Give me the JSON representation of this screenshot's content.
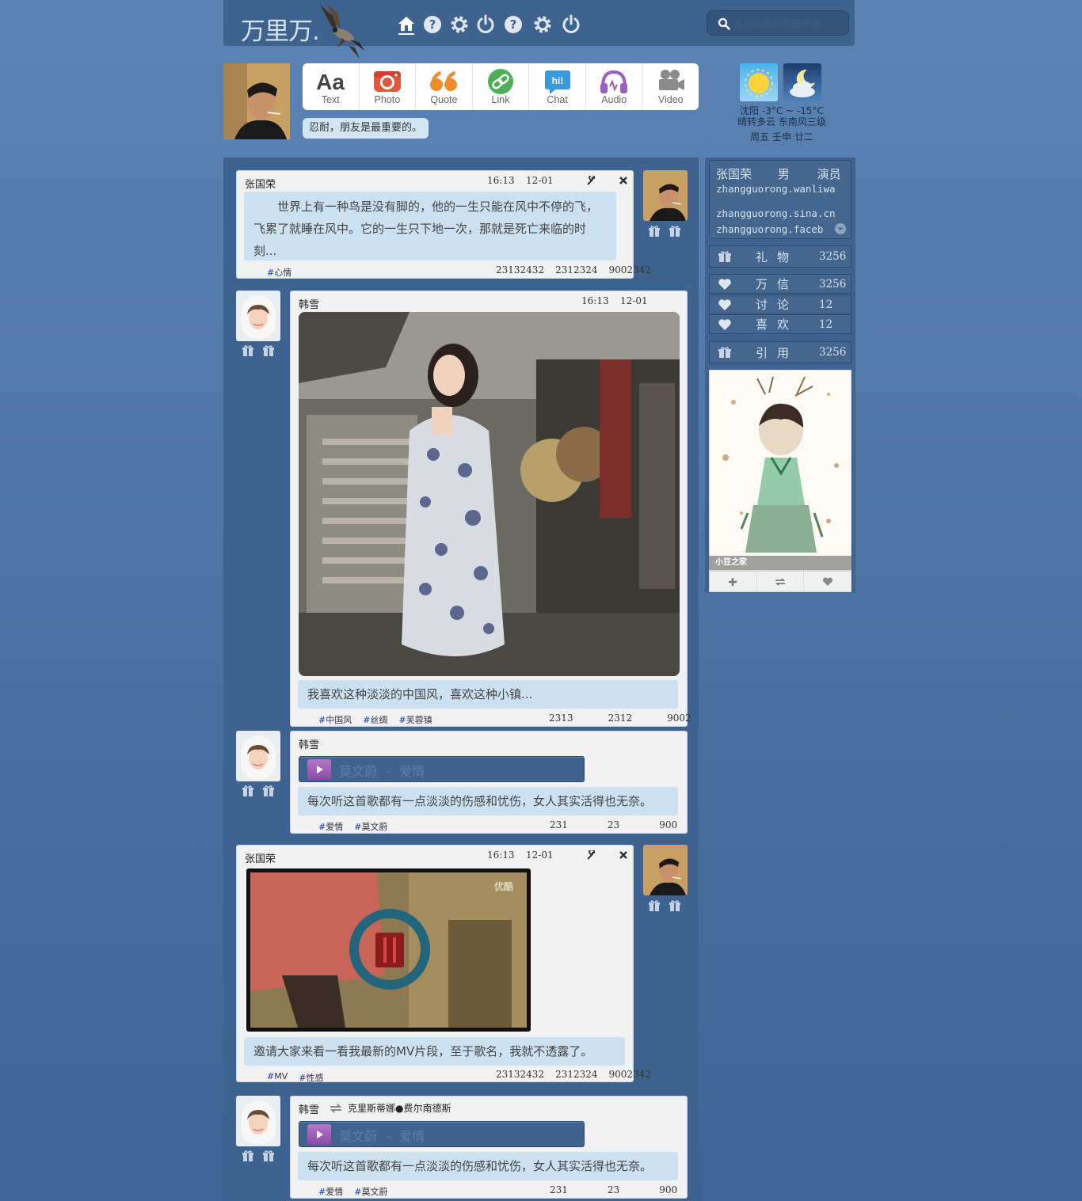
{
  "header": {
    "logo_text": "万里万.",
    "nav_icons": [
      "home-icon",
      "help-icon",
      "gear-icon",
      "power-icon",
      "help-icon",
      "gear-icon",
      "power-icon"
    ],
    "search_placeholder": "从您兴趣的标签开始"
  },
  "composer": {
    "buttons": [
      {
        "label": "Text",
        "icon": "text-aa-icon",
        "color": "#444444"
      },
      {
        "label": "Photo",
        "icon": "camera-icon",
        "color": "#e2583e"
      },
      {
        "label": "Quote",
        "icon": "quote-icon",
        "color": "#f08c2b"
      },
      {
        "label": "Link",
        "icon": "link-icon",
        "color": "#4eae5a"
      },
      {
        "label": "Chat",
        "icon": "chat-icon",
        "color": "#3a9ad9"
      },
      {
        "label": "Audio",
        "icon": "headphones-icon",
        "color": "#9b5fc0"
      },
      {
        "label": "Video",
        "icon": "video-camera-icon",
        "color": "#8a8a8a"
      }
    ]
  },
  "motto": "忍耐，朋友是最重要的。",
  "weather": {
    "line1": "沈阳   -3°C ~ -15°C",
    "line2": "晴转多云 东南风三级",
    "line3": "周五 壬申 廿二"
  },
  "posts": [
    {
      "author": "张国荣",
      "time": "16:13",
      "date": "12-01",
      "text": "世界上有一种鸟是没有脚的，他的一生只能在风中不停的飞，飞累了就睡在风中。它的一生只下地一次，那就是死亡来临的时刻...",
      "tags": [
        "心情"
      ],
      "stats": [
        "23132432",
        "2312324",
        "9002342"
      ]
    },
    {
      "author": "韩雪",
      "time": "16:13",
      "date": "12-01",
      "text": "我喜欢这种淡淡的中国风，喜欢这种小镇...",
      "tags": [
        "中国风",
        "丝绸",
        "芙蓉镇"
      ],
      "stats": [
        "2313",
        "2312",
        "9002"
      ]
    },
    {
      "author": "韩雪",
      "audio_artist": "莫文蔚",
      "audio_song": "爱情",
      "text": "每次听这首歌都有一点淡淡的伤感和忧伤，女人其实活得也无奈。",
      "tags": [
        "爱情",
        "莫文蔚"
      ],
      "stats": [
        "231",
        "23",
        "900"
      ]
    },
    {
      "author": "张国荣",
      "time": "16:13",
      "date": "12-01",
      "video_brand": "优酷",
      "text": "邀请大家来看一看我最新的MV片段，至于歌名，我就不透露了。",
      "tags": [
        "MV",
        "性感"
      ],
      "stats": [
        "23132432",
        "2312324",
        "9002342"
      ]
    },
    {
      "author": "韩雪",
      "repost_from": "克里斯蒂娜●费尔南德斯",
      "audio_artist": "莫文蔚",
      "audio_song": "爱情",
      "text": "每次听这首歌都有一点淡淡的伤感和忧伤，女人其实活得也无奈。",
      "tags": [
        "爱情",
        "莫文蔚"
      ],
      "stats": [
        "231",
        "23",
        "900"
      ]
    }
  ],
  "profile": {
    "name": "张国荣",
    "gender": "男",
    "job": "演员",
    "handle1": "zhangguorong.wanliwa",
    "handle2": "zhangguorong.sina.cn",
    "handle3": "zhangguorong.faceb"
  },
  "side_stats": [
    {
      "label": "礼物",
      "value": "3256",
      "icon": "gift-icon"
    },
    {
      "label": "万信",
      "value": "3256",
      "icon": "heart-icon"
    },
    {
      "label": "讨论",
      "value": "12",
      "icon": "heart-icon"
    },
    {
      "label": "喜欢",
      "value": "12",
      "icon": "heart-icon"
    },
    {
      "label": "引用",
      "value": "3256",
      "icon": "gift-icon"
    }
  ],
  "side_image_caption": "小豆之家",
  "audio_separator": "-"
}
